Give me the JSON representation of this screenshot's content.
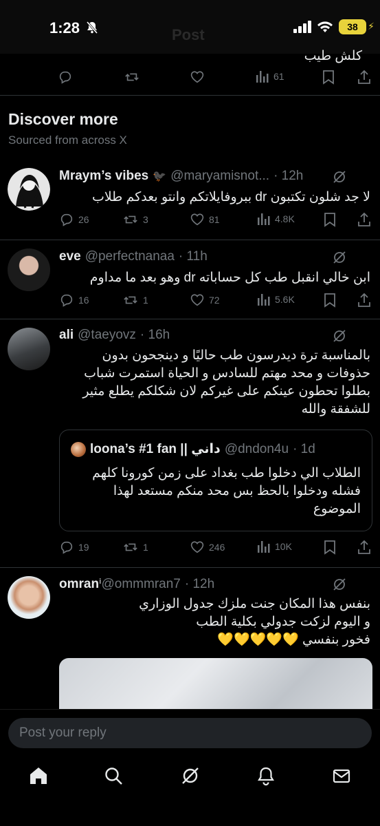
{
  "status_bar": {
    "time": "1:28",
    "battery": "38"
  },
  "header": {
    "title": "Post"
  },
  "top_reply": {
    "text": "كلش طيب",
    "views": "61"
  },
  "discover": {
    "title": "Discover more",
    "subtitle": "Sourced from across X"
  },
  "posts": [
    {
      "name": "Mraym’s vibes",
      "emoji": "🐦‍⬛",
      "handle": "@maryamisnot...",
      "time": "· 12h",
      "text": "لا جد شلون تكتبون dr ببروفايلاتكم وانتو بعدكم طلاب",
      "replies": "26",
      "reposts": "3",
      "likes": "81",
      "views": "4.8K"
    },
    {
      "name": "eve",
      "handle": "@perfectnanaa",
      "time": "· 11h",
      "text": "ابن خالي انقبل طب كل حساباته dr وهو بعد ما مداوم",
      "replies": "16",
      "reposts": "1",
      "likes": "72",
      "views": "5.6K"
    },
    {
      "name": "ali",
      "handle": "@taeyovz",
      "time": "· 16h",
      "text": "بالمناسبة ترة ديدرسون طب حاليًا و دينجحون بدون\nحذوفات و محد مهتم للسادس و الحياة استمرت شباب\nبطلوا تحطون عينكم على غيركم لان شكلكم يطلع مثير\nللشفقة والله",
      "quote": {
        "name": "loona’s #1 fan || داني",
        "handle": "@dndon4u",
        "time": "· 1d",
        "text": "الطلاب الي دخلوا طب بغداد على زمن كورونا كلهم\nفشله ودخلوا بالحظ بس محد منكم مستعد لهذا\nالموضوع"
      },
      "replies": "19",
      "reposts": "1",
      "likes": "246",
      "views": "10K"
    },
    {
      "name": "omran",
      "verified_mark": "ⁱ",
      "handle": "@ommmran7",
      "time": "· 12h",
      "text": "بنفس هذا المكان جنت ملزك جدول الوزاري\nو اليوم لزكت جدولي بكلية الطب\nفخور بنفسي 💛💛💛💛💛"
    }
  ],
  "composer": {
    "placeholder": "Post your reply"
  },
  "tabs": [
    "home",
    "search",
    "grok",
    "notifications",
    "messages"
  ],
  "colors": {
    "background": "#000000",
    "text": "#e7e9ea",
    "muted": "#71767b",
    "divider": "#2f3336",
    "battery": "#e8d33b"
  }
}
